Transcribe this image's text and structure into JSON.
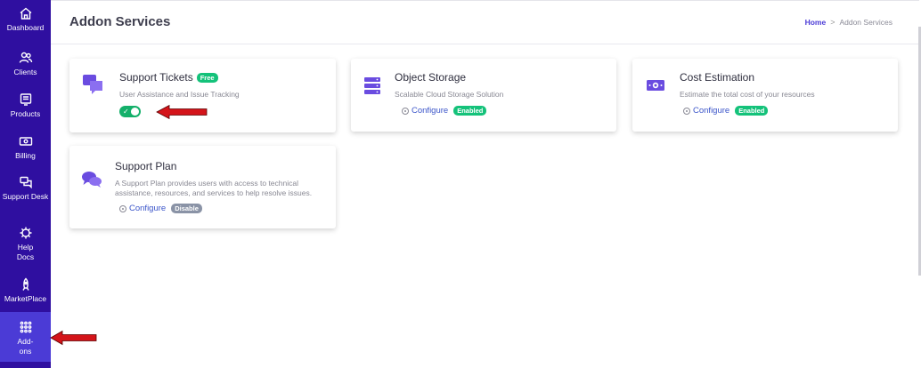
{
  "sidebar": {
    "items": [
      {
        "label": "Dashboard",
        "icon": "home-icon"
      },
      {
        "label": "Clients",
        "icon": "users-icon"
      },
      {
        "label": "Products",
        "icon": "products-icon"
      },
      {
        "label": "Billing",
        "icon": "billing-icon"
      },
      {
        "label": "Support Desk",
        "icon": "support-desk-icon"
      },
      {
        "label": "Help Docs",
        "icon": "help-docs-icon"
      },
      {
        "label": "MarketPlace",
        "icon": "marketplace-icon"
      },
      {
        "label": "Add-ons",
        "icon": "addons-grid-icon"
      }
    ],
    "background": "#2f0fa0",
    "active_background": "#4b3bd6"
  },
  "header": {
    "title": "Addon Services",
    "breadcrumb": {
      "home": "Home",
      "separator": ">",
      "current": "Addon Services"
    }
  },
  "cards": [
    {
      "title": "Support Tickets",
      "badge": "Free",
      "description": "User Assistance and Issue Tracking",
      "icon": "chat-bubbles-icon",
      "toggle_on": true
    },
    {
      "title": "Object Storage",
      "description": "Scalable Cloud Storage Solution",
      "icon": "server-storage-icon",
      "configure_label": "Configure",
      "status": "Enabled"
    },
    {
      "title": "Cost Estimation",
      "description": "Estimate the total cost of your resources",
      "icon": "money-icon",
      "configure_label": "Configure",
      "status": "Enabled"
    },
    {
      "title": "Support Plan",
      "description_line1": "A Support Plan provides users with access to technical",
      "description_line2": "assistance, resources, and services to help resolve issues.",
      "icon": "conversation-icon",
      "configure_label": "Configure",
      "status": "Disable"
    }
  ],
  "colors": {
    "accent": "#4b3bd6",
    "icon_purple": "#6a4ce0",
    "success": "#14c27a",
    "muted_badge": "#8a93a6",
    "arrow": "#d4141a"
  }
}
